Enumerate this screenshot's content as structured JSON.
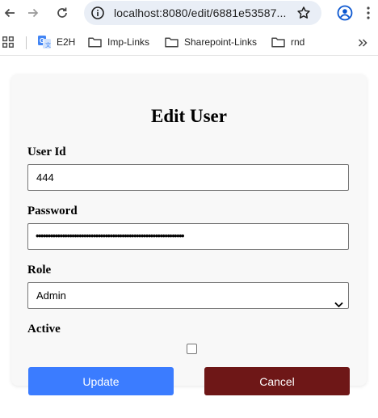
{
  "browser": {
    "url": "localhost:8080/edit/6881e53587...",
    "bookmarks": [
      {
        "label": "E2H",
        "icon": "g-translate-icon"
      },
      {
        "label": "Imp-Links",
        "icon": "folder-icon"
      },
      {
        "label": "Sharepoint-Links",
        "icon": "folder-icon"
      },
      {
        "label": "rnd",
        "icon": "folder-icon"
      }
    ]
  },
  "form": {
    "title": "Edit User",
    "user_id_label": "User Id",
    "user_id_value": "444",
    "password_label": "Password",
    "password_mask": "••••••••••••••••••••••••••••••••••••••••••••••••••••••••••••••",
    "role_label": "Role",
    "role_value": "Admin",
    "active_label": "Active",
    "active_checked": false,
    "update_label": "Update",
    "cancel_label": "Cancel"
  },
  "colors": {
    "update_button": "#3b7cff",
    "cancel_button": "#6e1717",
    "card_background": "#f8f8f8"
  }
}
